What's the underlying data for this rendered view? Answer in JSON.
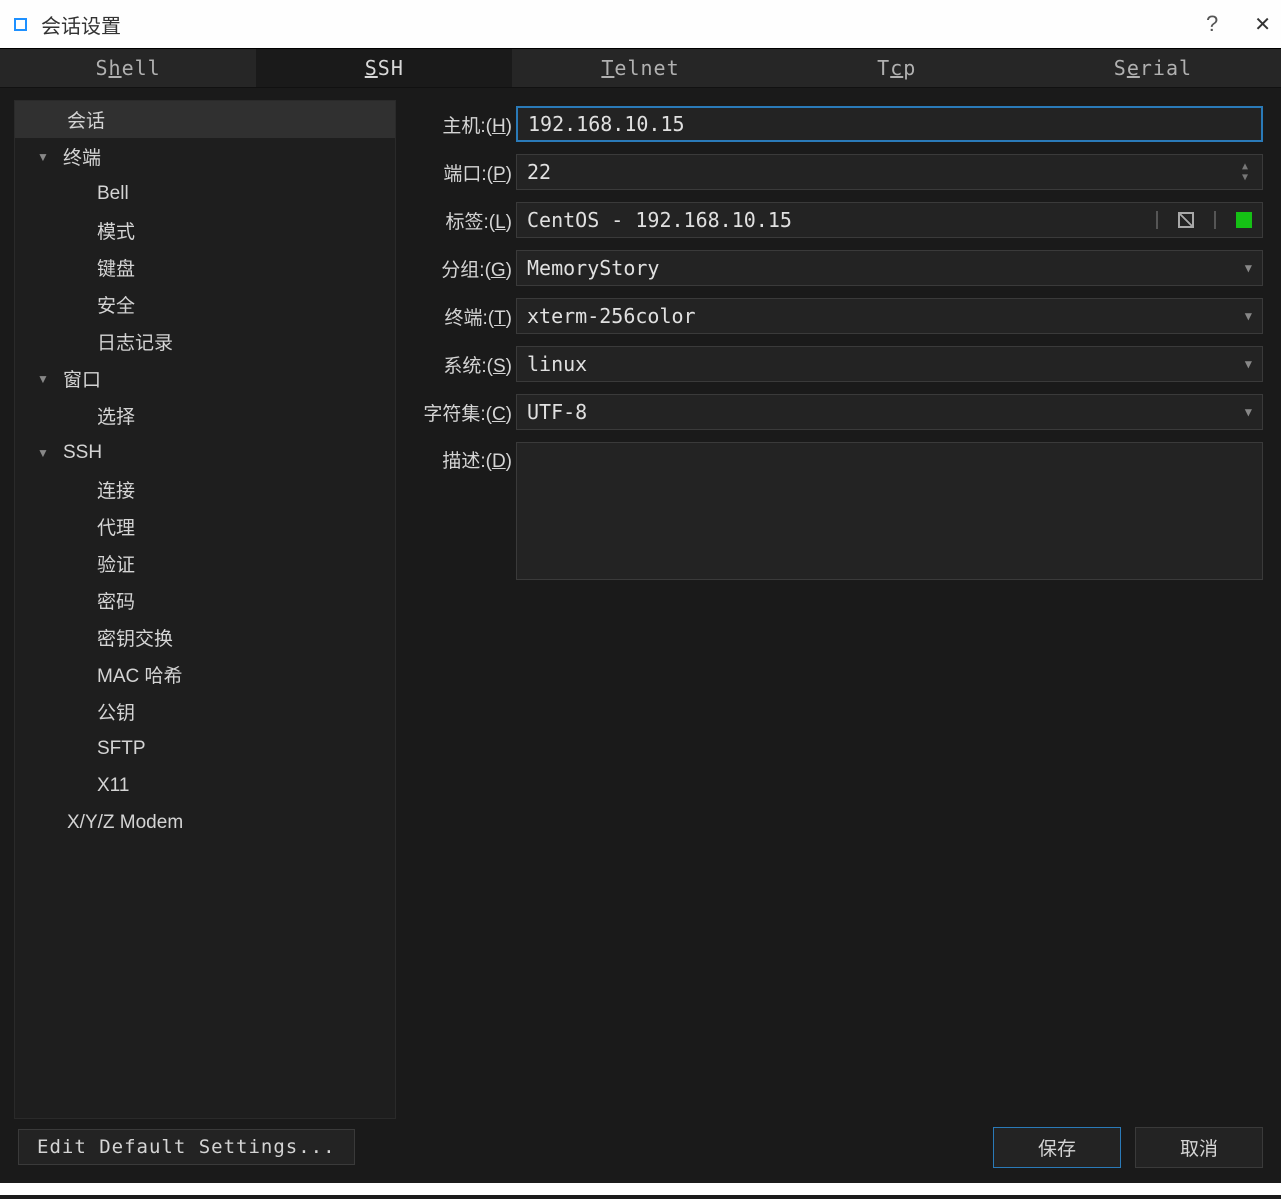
{
  "window": {
    "title": "会话设置"
  },
  "tabs": {
    "shell": "Shell",
    "ssh": "SSH",
    "telnet": "Telnet",
    "tcp": "Tcp",
    "serial": "Serial"
  },
  "sidebar": {
    "session": "会话",
    "terminal": {
      "label": "终端",
      "items": [
        "Bell",
        "模式",
        "键盘",
        "安全",
        "日志记录"
      ]
    },
    "window": {
      "label": "窗口",
      "items": [
        "选择"
      ]
    },
    "ssh": {
      "label": "SSH",
      "items": [
        "连接",
        "代理",
        "验证",
        "密码",
        "密钥交换",
        "MAC 哈希",
        "公钥",
        "SFTP",
        "X11"
      ]
    },
    "modem": "X/Y/Z Modem"
  },
  "form": {
    "host": {
      "label": "主机:",
      "key": "H",
      "value": "192.168.10.15"
    },
    "port": {
      "label": "端口:",
      "key": "P",
      "value": "22"
    },
    "tag": {
      "label": "标签:",
      "key": "L",
      "value": "CentOS - 192.168.10.15"
    },
    "group": {
      "label": "分组:",
      "key": "G",
      "value": "MemoryStory"
    },
    "term": {
      "label": "终端:",
      "key": "T",
      "value": "xterm-256color"
    },
    "system": {
      "label": "系统:",
      "key": "S",
      "value": "linux"
    },
    "charset": {
      "label": "字符集:",
      "key": "C",
      "value": "UTF-8"
    },
    "desc": {
      "label": "描述:",
      "key": "D",
      "value": ""
    }
  },
  "footer": {
    "edit_defaults": "Edit Default Settings...",
    "save": "保存",
    "cancel": "取消"
  },
  "colors": {
    "status": "#15c015"
  }
}
